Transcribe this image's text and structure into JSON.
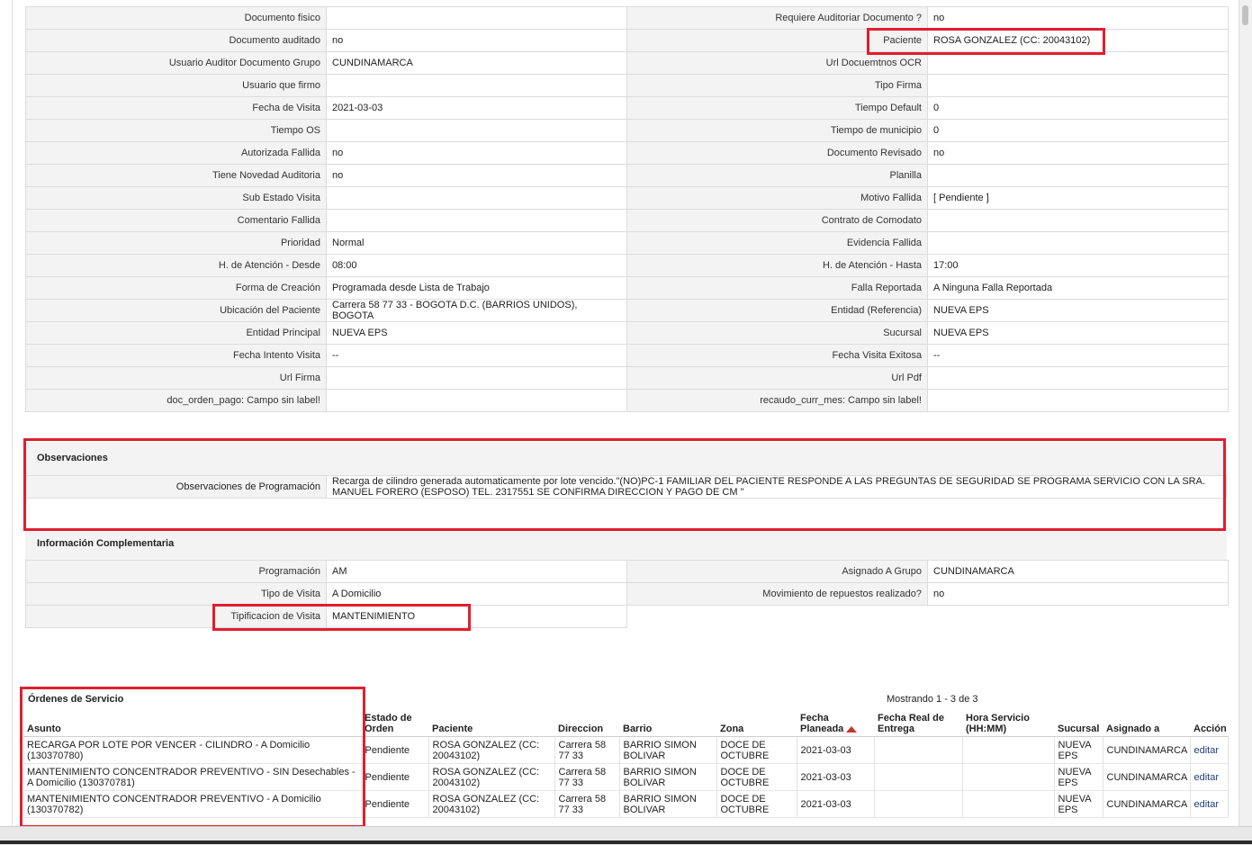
{
  "details": [
    {
      "l1": "Documento fisico",
      "v1": "",
      "l2": "Requiere Auditoriar Documento ?",
      "v2": "no"
    },
    {
      "l1": "Documento auditado",
      "v1": "no",
      "l2": "Paciente",
      "v2": "ROSA GONZALEZ (CC: 20043102)"
    },
    {
      "l1": "Usuario Auditor Documento Grupo",
      "v1": "CUNDINAMARCA",
      "l2": "Url Docuemtnos OCR",
      "v2": ""
    },
    {
      "l1": "Usuario que firmo",
      "v1": "",
      "l2": "Tipo Firma",
      "v2": ""
    },
    {
      "l1": "Fecha de Visita",
      "v1": "2021-03-03",
      "l2": "Tiempo Default",
      "v2": "0"
    },
    {
      "l1": "Tiempo OS",
      "v1": "",
      "l2": "Tiempo de municipio",
      "v2": "0"
    },
    {
      "l1": "Autorizada Fallida",
      "v1": "no",
      "l2": "Documento Revisado",
      "v2": "no"
    },
    {
      "l1": "Tiene Novedad Auditoria",
      "v1": "no",
      "l2": "Planilla",
      "v2": ""
    },
    {
      "l1": "Sub Estado Visita",
      "v1": "",
      "l2": "Motivo Fallida",
      "v2": "[ Pendiente ]"
    },
    {
      "l1": "Comentario Fallida",
      "v1": "",
      "l2": "Contrato de Comodato",
      "v2": ""
    },
    {
      "l1": "Prioridad",
      "v1": "Normal",
      "l2": "Evidencia Fallida",
      "v2": ""
    },
    {
      "l1": "H. de Atención - Desde",
      "v1": "08:00",
      "l2": "H. de Atención - Hasta",
      "v2": "17:00"
    },
    {
      "l1": "Forma de Creación",
      "v1": "Programada desde Lista de Trabajo",
      "l2": "Falla Reportada",
      "v2": "A Ninguna Falla Reportada"
    },
    {
      "l1": "Ubicación del Paciente",
      "v1": "Carrera 58 77 33 - BOGOTA D.C. (BARRIOS UNIDOS), BOGOTA",
      "l2": "Entidad (Referencia)",
      "v2": "NUEVA EPS"
    },
    {
      "l1": "Entidad Principal",
      "v1": "NUEVA EPS",
      "l2": "Sucursal",
      "v2": "NUEVA EPS"
    },
    {
      "l1": "Fecha Intento Visita",
      "v1": "--",
      "l2": "Fecha Visita Exitosa",
      "v2": "--"
    },
    {
      "l1": "Url Firma",
      "v1": "",
      "l2": "Url Pdf",
      "v2": ""
    },
    {
      "l1": "doc_orden_pago: Campo sin label!",
      "v1": "",
      "l2": "recaudo_curr_mes: Campo sin label!",
      "v2": ""
    }
  ],
  "observaciones": {
    "title": "Observaciones",
    "label": "Observaciones de Programación",
    "value": "Recarga de cilindro generada automaticamente por lote vencido.\"(NO)PC-1 FAMILIAR DEL PACIENTE RESPONDE A LAS PREGUNTAS DE SEGURIDAD SE PROGRAMA SERVICIO CON LA SRA. MANUEL FORERO (ESPOSO) TEL. 2317551 SE CONFIRMA DIRECCION Y PAGO DE CM \""
  },
  "info": {
    "title": "Información Complementaria",
    "rows": [
      {
        "l1": "Programación",
        "v1": "AM",
        "l2": "Asignado A Grupo",
        "v2": "CUNDINAMARCA"
      },
      {
        "l1": "Tipo de Visita",
        "v1": "A Domicilio",
        "l2": "Movimiento de repuestos realizado?",
        "v2": "no"
      },
      {
        "l1": "Tipificacion de Visita",
        "v1": "MANTENIMIENTO"
      }
    ]
  },
  "orders": {
    "title": "Órdenes de Servicio",
    "showing": "Mostrando 1 - 3 de 3",
    "headers": [
      "Asunto",
      "Estado de Orden",
      "Paciente",
      "Direccion",
      "Barrio",
      "Zona",
      "Fecha Planeada",
      "Fecha Real de Entrega",
      "Hora Servicio (HH:MM)",
      "Sucursal",
      "Asignado a",
      "Acción"
    ],
    "rows": [
      {
        "asunto": "RECARGA POR LOTE POR VENCER - CILINDRO - A Domicilio (130370780)",
        "estado": "Pendiente",
        "paciente": "ROSA GONZALEZ (CC: 20043102)",
        "direccion": "Carrera 58 77 33",
        "barrio": "BARRIO SIMON BOLIVAR",
        "zona": "DOCE DE OCTUBRE",
        "fecha_planeada": "2021-03-03",
        "fecha_real": "",
        "hora": "",
        "sucursal": "NUEVA EPS",
        "asignado": "CUNDINAMARCA",
        "accion": "editar"
      },
      {
        "asunto": "MANTENIMIENTO CONCENTRADOR PREVENTIVO - SIN Desechables - A Domicilio (130370781)",
        "estado": "Pendiente",
        "paciente": "ROSA GONZALEZ (CC: 20043102)",
        "direccion": "Carrera 58 77 33",
        "barrio": "BARRIO SIMON BOLIVAR",
        "zona": "DOCE DE OCTUBRE",
        "fecha_planeada": "2021-03-03",
        "fecha_real": "",
        "hora": "",
        "sucursal": "NUEVA EPS",
        "asignado": "CUNDINAMARCA",
        "accion": "editar"
      },
      {
        "asunto": "MANTENIMIENTO CONCENTRADOR PREVENTIVO - A Domicilio (130370782)",
        "estado": "Pendiente",
        "paciente": "ROSA GONZALEZ (CC: 20043102)",
        "direccion": "Carrera 58 77 33",
        "barrio": "BARRIO SIMON BOLIVAR",
        "zona": "DOCE DE OCTUBRE",
        "fecha_planeada": "2021-03-03",
        "fecha_real": "",
        "hora": "",
        "sucursal": "NUEVA EPS",
        "asignado": "CUNDINAMARCA",
        "accion": "editar"
      }
    ]
  },
  "colors": {
    "highlight": "#e01e2e",
    "label_bg": "#f3f3f3",
    "border": "#dcdcdc",
    "link": "#1f3f7a"
  }
}
